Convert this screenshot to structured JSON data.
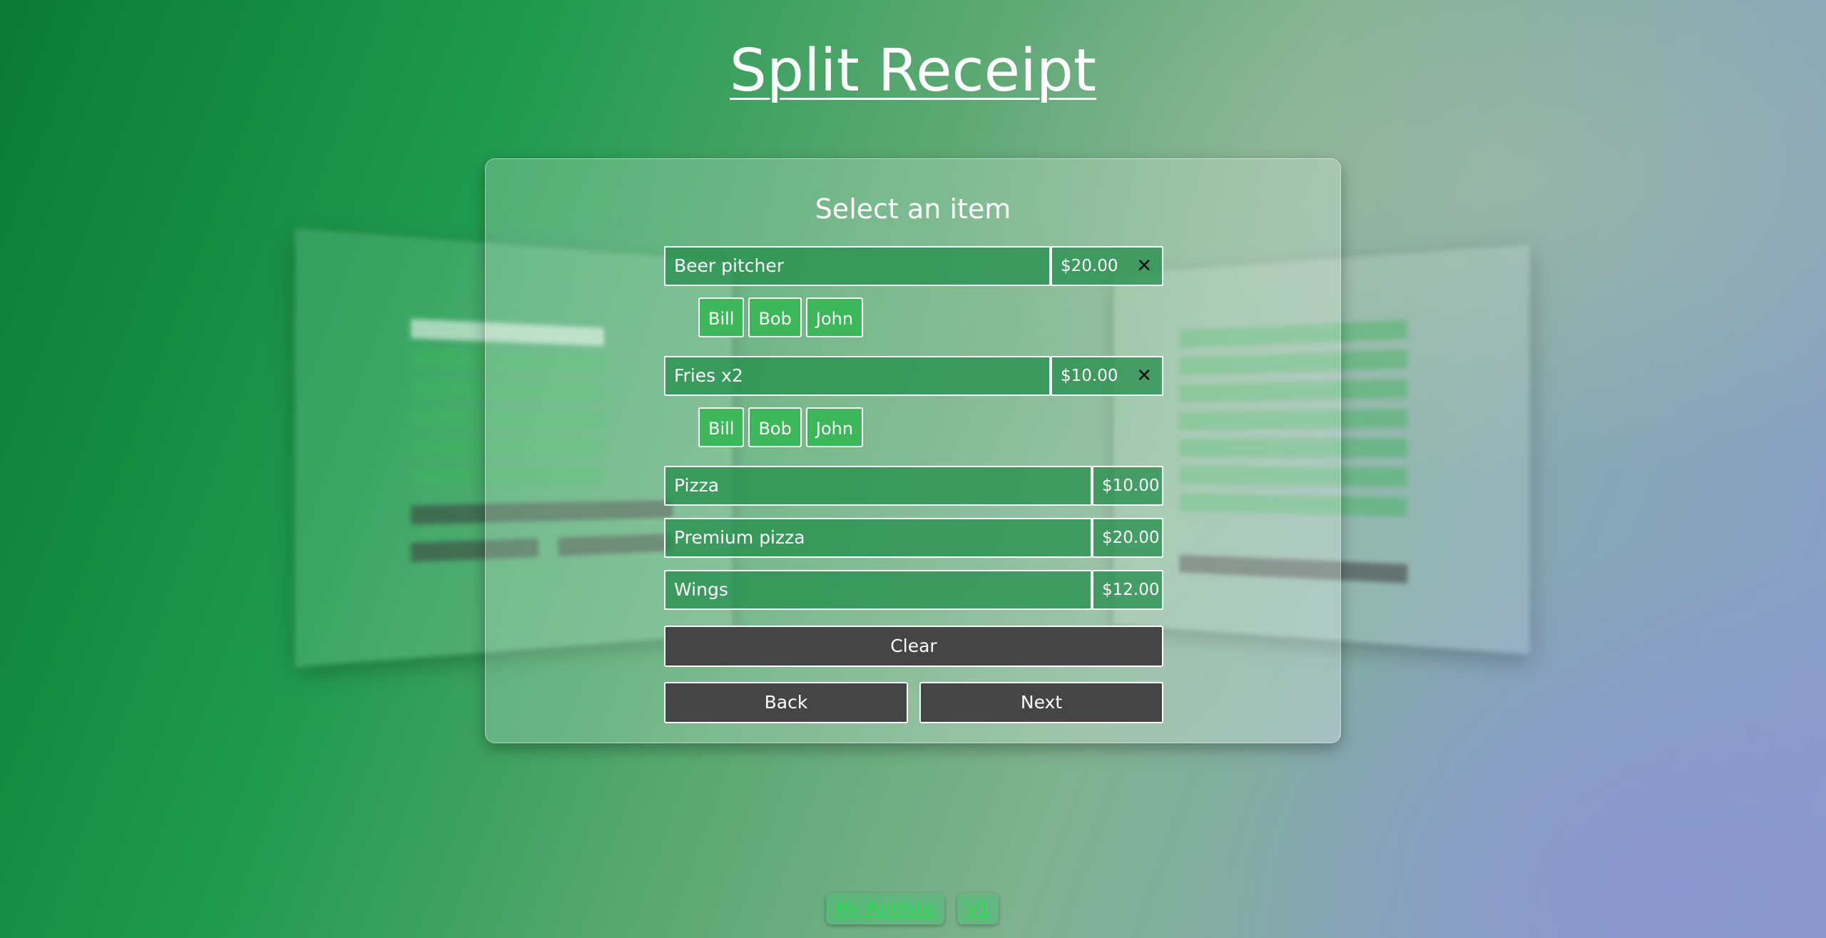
{
  "page": {
    "title": "Split Receipt"
  },
  "card": {
    "title": "Select an item",
    "items": [
      {
        "name": "Beer pitcher",
        "price": "$20.00",
        "remove": "✕",
        "people": [
          "Bill",
          "Bob",
          "John"
        ]
      },
      {
        "name": "Fries x2",
        "price": "$10.00",
        "remove": "✕",
        "people": [
          "Bill",
          "Bob",
          "John"
        ]
      },
      {
        "name": "Pizza",
        "price": "$10.00"
      },
      {
        "name": "Premium pizza",
        "price": "$20.00"
      },
      {
        "name": "Wings",
        "price": "$12.00"
      }
    ],
    "clear_label": "Clear",
    "back_label": "Back",
    "next_label": "Next"
  },
  "footer": {
    "portfolio_label": "My Portfolio",
    "version_label": "V1"
  },
  "colors": {
    "item_bg": "#1e8c46",
    "person_bg": "#3cb85a",
    "button_bg": "#454545",
    "link": "#22e04a"
  }
}
